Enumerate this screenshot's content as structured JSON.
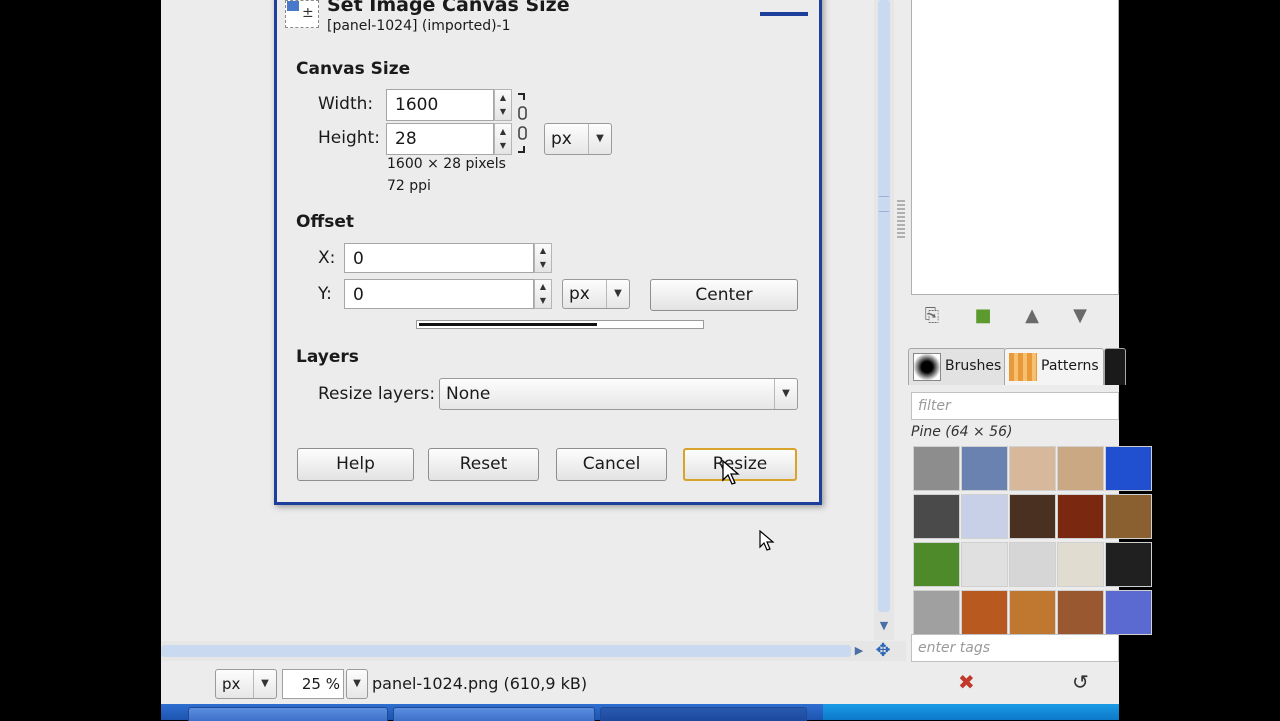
{
  "dialog": {
    "title": "Set Image Canvas Size",
    "subtitle": "[panel-1024] (imported)-1",
    "canvas_size": {
      "heading": "Canvas Size",
      "width_label": "Width:",
      "width_value": "1600",
      "height_label": "Height:",
      "height_value": "28",
      "unit": "px",
      "info_pixels": "1600 × 28 pixels",
      "info_ppi": "72 ppi"
    },
    "offset": {
      "heading": "Offset",
      "x_label": "X:",
      "x_value": "0",
      "y_label": "Y:",
      "y_value": "0",
      "unit": "px",
      "center_label": "Center",
      "preview_fill_fraction": 0.63
    },
    "layers": {
      "heading": "Layers",
      "resize_label": "Resize layers:",
      "resize_value": "None"
    },
    "buttons": {
      "help": "Help",
      "reset": "Reset",
      "cancel": "Cancel",
      "resize": "Resize"
    }
  },
  "statusbar": {
    "unit": "px",
    "zoom": "25 %",
    "file_info": "panel-1024.png (610,9 kB)"
  },
  "dock": {
    "tabs": [
      {
        "label": "Brushes"
      },
      {
        "label": "Patterns"
      }
    ],
    "filter_placeholder": "filter",
    "pattern_name": "Pine (64 × 56)",
    "tags_placeholder": "enter tags",
    "patterns": [
      "#8d8d8d",
      "#6a82b0",
      "#d8b89a",
      "#c9a883",
      "#2050d0",
      "#4a4a4a",
      "#c8d0e8",
      "#4a3020",
      "#7a2810",
      "#8a6030",
      "#4f8a2a",
      "#e0e0e0",
      "#d6d6d6",
      "#e0dccf",
      "#202020",
      "#a0a0a0",
      "#b85a20",
      "#c07830",
      "#9a5830",
      "#5a6ad0"
    ]
  }
}
